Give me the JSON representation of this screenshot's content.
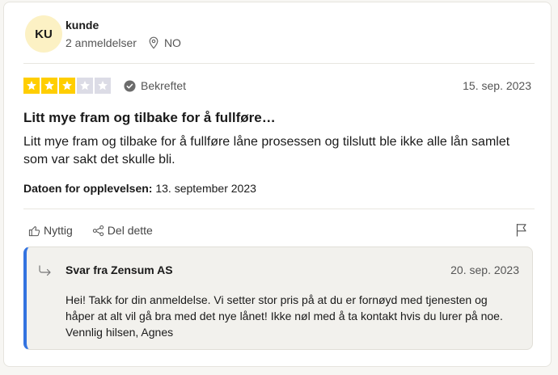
{
  "reviewer": {
    "initials": "KU",
    "name": "kunde",
    "review_count": "2 anmeldelser",
    "country": "NO"
  },
  "review": {
    "rating": 3,
    "max_rating": 5,
    "star_color": "#ffce00",
    "empty_star_color": "#dcdce6",
    "verified_label": "Bekreftet",
    "date": "15. sep. 2023",
    "title": "Litt mye fram og tilbake for å fullføre…",
    "body_line1": "Litt mye fram og tilbake for å fullføre låne prosessen og tilslutt ble ikke alle lån samlet",
    "body_line2": "som var sakt det skulle bli.",
    "experience_label": "Datoen for opplevelsen:",
    "experience_date": " 13. september 2023"
  },
  "actions": {
    "useful_label": "Nyttig",
    "share_label": "Del dette"
  },
  "reply": {
    "title": "Svar fra Zensum AS",
    "date": "20. sep. 2023",
    "line1": "Hei! Takk for din anmeldelse. Vi setter stor pris på at du er fornøyd med tjenesten og",
    "line2": "håper at alt vil gå bra med det nye lånet! Ikke nøl med å ta kontakt hvis du lurer på noe.",
    "line3": "Vennlig hilsen, Agnes",
    "accent_color": "#3373e0"
  }
}
